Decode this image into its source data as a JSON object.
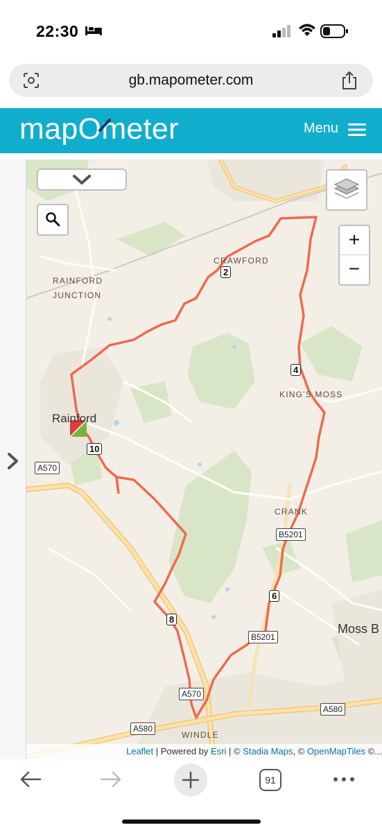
{
  "status_bar": {
    "time": "22:30",
    "icons": [
      "bed-icon",
      "signal-icon",
      "wifi-icon",
      "battery-icon"
    ]
  },
  "browser": {
    "url": "gb.mapometer.com",
    "tab_count": "91",
    "icons": [
      "reader-icon",
      "share-icon",
      "back-arrow-icon",
      "forward-arrow-icon",
      "plus-icon",
      "more-icon"
    ]
  },
  "site": {
    "logo_text_left": "map",
    "logo_text_mid": "O",
    "logo_text_right": "meter",
    "menu_label": "Menu",
    "brand_color": "#11adcc"
  },
  "map": {
    "zoom_in": "+",
    "zoom_out": "−",
    "route_color": "#ee6a4e",
    "places": {
      "crawford": "CRAWFORD",
      "rainford_junction_1": "RAINFORD",
      "rainford_junction_2": "JUNCTION",
      "kings_moss": "KING'S MOSS",
      "crank": "CRANK",
      "windle": "WINDLE",
      "rainford": "Rainford",
      "moss_bank": "Moss B"
    },
    "roads": {
      "a570_west": "A570",
      "b5201_north": "B5201",
      "b5201_south": "B5201",
      "a570_south": "A570",
      "a580_west": "A580",
      "a580_east": "A580"
    },
    "distance_markers": [
      "2",
      "4",
      "6",
      "8",
      "10"
    ],
    "attribution": {
      "leaflet": "Leaflet",
      "sep1": " | Powered by ",
      "esri": "Esri",
      "sep2": " | © ",
      "stadia": "Stadia Maps",
      "sep3": ", © ",
      "omt": "OpenMapTiles",
      "tail": " ©..."
    }
  }
}
